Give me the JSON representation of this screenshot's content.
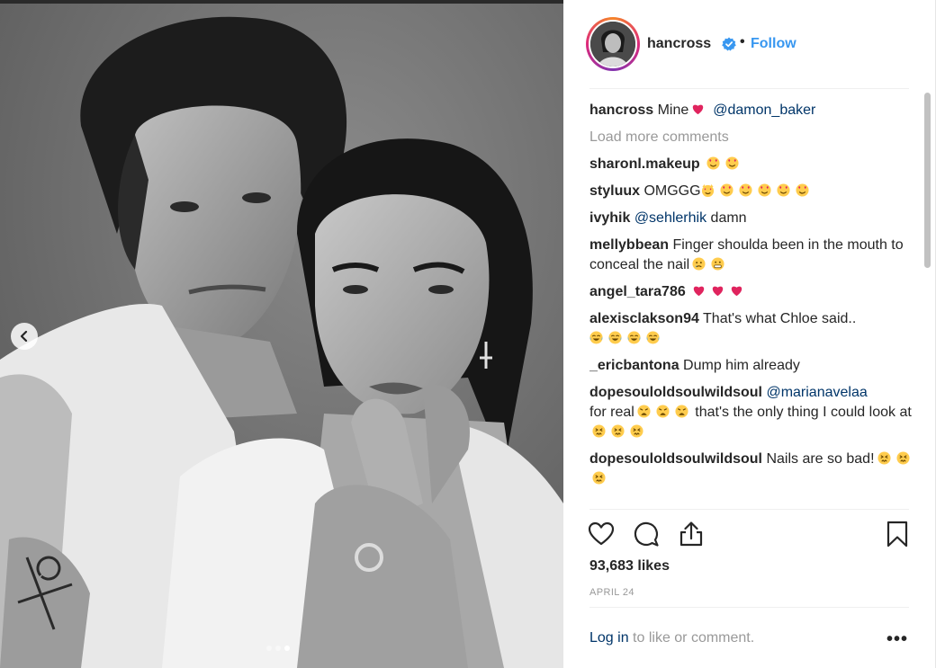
{
  "post": {
    "username": "hancross",
    "follow_label": "Follow",
    "separator": "•",
    "likes": "93,683 likes",
    "date": "APRIL 24",
    "login_link": "Log in",
    "login_rest": " to like or comment.",
    "more_options": "•••"
  },
  "carousel": {
    "slides": 3,
    "active": 2
  },
  "comments": {
    "caption": {
      "user": "hancross",
      "text": " Mine",
      "mention": "@damon_baker"
    },
    "load_more": "Load more comments",
    "items": [
      {
        "user": "sharonl.makeup",
        "text": ""
      },
      {
        "user": "styluux",
        "text": " OMGGG"
      },
      {
        "user": "ivyhik",
        "mention": "@sehlerhik",
        "text": " damn"
      },
      {
        "user": "mellybbean",
        "text": " Finger shoulda been in the mouth to conceal the nail"
      },
      {
        "user": "angel_tara786",
        "text": ""
      },
      {
        "user": "alexisclakson94",
        "text": " That's what Chloe said.."
      },
      {
        "user": "_ericbantona",
        "text": " Dump him already"
      },
      {
        "user": "dopesouloldsoulwildsoul",
        "mention": "@marianavelaa",
        "text_a": "for real",
        "text_b": "that's the only thing I could look at"
      },
      {
        "user": "dopesouloldsoulwildsoul",
        "text": " Nails are so bad!"
      }
    ]
  },
  "icons": {
    "verified": "verified-badge-icon",
    "like": "heart-icon",
    "comment": "comment-bubble-icon",
    "share": "share-icon",
    "save": "bookmark-icon",
    "prev": "chevron-left-icon"
  },
  "colors": {
    "link_blue": "#3897f0",
    "mention_blue": "#003569",
    "muted_gray": "#999999",
    "heart_red": "#e0245e"
  }
}
